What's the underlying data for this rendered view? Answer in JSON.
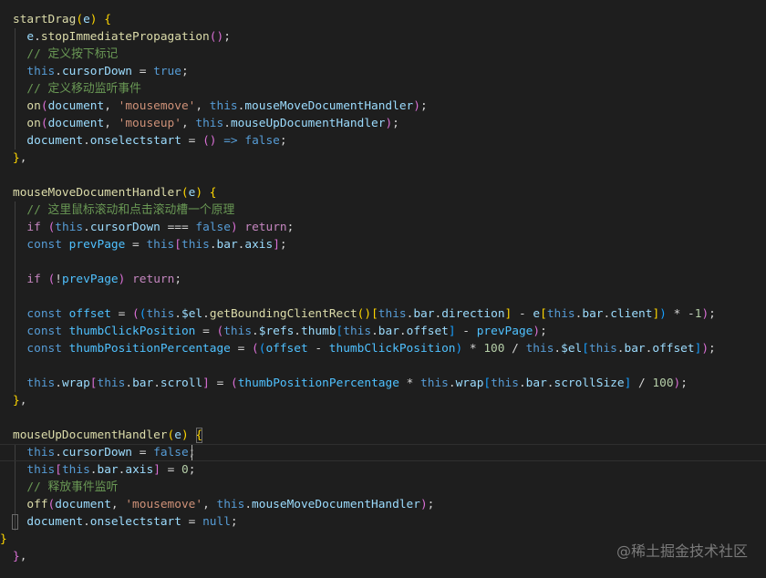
{
  "editor": {
    "lines": [
      [
        [
          "t-fn",
          "startDrag"
        ],
        [
          "t-br1",
          "("
        ],
        [
          "t-var",
          "e"
        ],
        [
          "t-br1",
          ")"
        ],
        [
          "t-pun",
          " "
        ],
        [
          "t-br1",
          "{"
        ]
      ],
      [
        [
          "t-pun",
          "  "
        ],
        [
          "t-var",
          "e"
        ],
        [
          "t-pun",
          "."
        ],
        [
          "t-fn",
          "stopImmediatePropagation"
        ],
        [
          "t-br2",
          "()"
        ],
        [
          "t-pun",
          ";"
        ]
      ],
      [
        [
          "t-pun",
          "  "
        ],
        [
          "t-cmt",
          "// 定义按下标记"
        ]
      ],
      [
        [
          "t-pun",
          "  "
        ],
        [
          "t-kw",
          "this"
        ],
        [
          "t-pun",
          "."
        ],
        [
          "t-var",
          "cursorDown"
        ],
        [
          "t-op",
          " = "
        ],
        [
          "t-kw",
          "true"
        ],
        [
          "t-pun",
          ";"
        ]
      ],
      [
        [
          "t-pun",
          "  "
        ],
        [
          "t-cmt",
          "// 定义移动监听事件"
        ]
      ],
      [
        [
          "t-pun",
          "  "
        ],
        [
          "t-fn",
          "on"
        ],
        [
          "t-br2",
          "("
        ],
        [
          "t-var",
          "document"
        ],
        [
          "t-pun",
          ", "
        ],
        [
          "t-str",
          "'mousemove'"
        ],
        [
          "t-pun",
          ", "
        ],
        [
          "t-kw",
          "this"
        ],
        [
          "t-pun",
          "."
        ],
        [
          "t-var",
          "mouseMoveDocumentHandler"
        ],
        [
          "t-br2",
          ")"
        ],
        [
          "t-pun",
          ";"
        ]
      ],
      [
        [
          "t-pun",
          "  "
        ],
        [
          "t-fn",
          "on"
        ],
        [
          "t-br2",
          "("
        ],
        [
          "t-var",
          "document"
        ],
        [
          "t-pun",
          ", "
        ],
        [
          "t-str",
          "'mouseup'"
        ],
        [
          "t-pun",
          ", "
        ],
        [
          "t-kw",
          "this"
        ],
        [
          "t-pun",
          "."
        ],
        [
          "t-var",
          "mouseUpDocumentHandler"
        ],
        [
          "t-br2",
          ")"
        ],
        [
          "t-pun",
          ";"
        ]
      ],
      [
        [
          "t-pun",
          "  "
        ],
        [
          "t-var",
          "document"
        ],
        [
          "t-pun",
          "."
        ],
        [
          "t-var",
          "onselectstart"
        ],
        [
          "t-op",
          " = "
        ],
        [
          "t-br2",
          "()"
        ],
        [
          "t-op",
          " "
        ],
        [
          "t-kw",
          "=>"
        ],
        [
          "t-pun",
          " "
        ],
        [
          "t-kw",
          "false"
        ],
        [
          "t-pun",
          ";"
        ]
      ],
      [
        [
          "t-br1",
          "}"
        ],
        [
          "t-pun",
          ","
        ]
      ],
      [],
      [
        [
          "t-fn",
          "mouseMoveDocumentHandler"
        ],
        [
          "t-br1",
          "("
        ],
        [
          "t-var",
          "e"
        ],
        [
          "t-br1",
          ")"
        ],
        [
          "t-pun",
          " "
        ],
        [
          "t-br1",
          "{"
        ]
      ],
      [
        [
          "t-pun",
          "  "
        ],
        [
          "t-cmt",
          "// 这里鼠标滚动和点击滚动槽一个原理"
        ]
      ],
      [
        [
          "t-pun",
          "  "
        ],
        [
          "t-ctrl",
          "if"
        ],
        [
          "t-pun",
          " "
        ],
        [
          "t-br2",
          "("
        ],
        [
          "t-kw",
          "this"
        ],
        [
          "t-pun",
          "."
        ],
        [
          "t-var",
          "cursorDown"
        ],
        [
          "t-op",
          " === "
        ],
        [
          "t-kw",
          "false"
        ],
        [
          "t-br2",
          ")"
        ],
        [
          "t-pun",
          " "
        ],
        [
          "t-ctrl",
          "return"
        ],
        [
          "t-pun",
          ";"
        ]
      ],
      [
        [
          "t-pun",
          "  "
        ],
        [
          "t-kw",
          "const"
        ],
        [
          "t-pun",
          " "
        ],
        [
          "t-const",
          "prevPage"
        ],
        [
          "t-op",
          " = "
        ],
        [
          "t-kw",
          "this"
        ],
        [
          "t-br2",
          "["
        ],
        [
          "t-kw",
          "this"
        ],
        [
          "t-pun",
          "."
        ],
        [
          "t-var",
          "bar"
        ],
        [
          "t-pun",
          "."
        ],
        [
          "t-var",
          "axis"
        ],
        [
          "t-br2",
          "]"
        ],
        [
          "t-pun",
          ";"
        ]
      ],
      [],
      [
        [
          "t-pun",
          "  "
        ],
        [
          "t-ctrl",
          "if"
        ],
        [
          "t-pun",
          " "
        ],
        [
          "t-br2",
          "("
        ],
        [
          "t-op",
          "!"
        ],
        [
          "t-const",
          "prevPage"
        ],
        [
          "t-br2",
          ")"
        ],
        [
          "t-pun",
          " "
        ],
        [
          "t-ctrl",
          "return"
        ],
        [
          "t-pun",
          ";"
        ]
      ],
      [],
      [
        [
          "t-pun",
          "  "
        ],
        [
          "t-kw",
          "const"
        ],
        [
          "t-pun",
          " "
        ],
        [
          "t-const",
          "offset"
        ],
        [
          "t-op",
          " = "
        ],
        [
          "t-br2",
          "("
        ],
        [
          "t-br3",
          "("
        ],
        [
          "t-kw",
          "this"
        ],
        [
          "t-pun",
          "."
        ],
        [
          "t-var",
          "$el"
        ],
        [
          "t-pun",
          "."
        ],
        [
          "t-fn",
          "getBoundingClientRect"
        ],
        [
          "t-br1",
          "()"
        ],
        [
          "t-br1",
          "["
        ],
        [
          "t-kw",
          "this"
        ],
        [
          "t-pun",
          "."
        ],
        [
          "t-var",
          "bar"
        ],
        [
          "t-pun",
          "."
        ],
        [
          "t-var",
          "direction"
        ],
        [
          "t-br1",
          "]"
        ],
        [
          "t-op",
          " - "
        ],
        [
          "t-var",
          "e"
        ],
        [
          "t-br1",
          "["
        ],
        [
          "t-kw",
          "this"
        ],
        [
          "t-pun",
          "."
        ],
        [
          "t-var",
          "bar"
        ],
        [
          "t-pun",
          "."
        ],
        [
          "t-var",
          "client"
        ],
        [
          "t-br1",
          "]"
        ],
        [
          "t-br3",
          ")"
        ],
        [
          "t-op",
          " * "
        ],
        [
          "t-op",
          "-"
        ],
        [
          "t-num",
          "1"
        ],
        [
          "t-br2",
          ")"
        ],
        [
          "t-pun",
          ";"
        ]
      ],
      [
        [
          "t-pun",
          "  "
        ],
        [
          "t-kw",
          "const"
        ],
        [
          "t-pun",
          " "
        ],
        [
          "t-const",
          "thumbClickPosition"
        ],
        [
          "t-op",
          " = "
        ],
        [
          "t-br2",
          "("
        ],
        [
          "t-kw",
          "this"
        ],
        [
          "t-pun",
          "."
        ],
        [
          "t-var",
          "$refs"
        ],
        [
          "t-pun",
          "."
        ],
        [
          "t-var",
          "thumb"
        ],
        [
          "t-br3",
          "["
        ],
        [
          "t-kw",
          "this"
        ],
        [
          "t-pun",
          "."
        ],
        [
          "t-var",
          "bar"
        ],
        [
          "t-pun",
          "."
        ],
        [
          "t-var",
          "offset"
        ],
        [
          "t-br3",
          "]"
        ],
        [
          "t-op",
          " - "
        ],
        [
          "t-const",
          "prevPage"
        ],
        [
          "t-br2",
          ")"
        ],
        [
          "t-pun",
          ";"
        ]
      ],
      [
        [
          "t-pun",
          "  "
        ],
        [
          "t-kw",
          "const"
        ],
        [
          "t-pun",
          " "
        ],
        [
          "t-const",
          "thumbPositionPercentage"
        ],
        [
          "t-op",
          " = "
        ],
        [
          "t-br2",
          "("
        ],
        [
          "t-br3",
          "("
        ],
        [
          "t-const",
          "offset"
        ],
        [
          "t-op",
          " - "
        ],
        [
          "t-const",
          "thumbClickPosition"
        ],
        [
          "t-br3",
          ")"
        ],
        [
          "t-op",
          " * "
        ],
        [
          "t-num",
          "100"
        ],
        [
          "t-op",
          " / "
        ],
        [
          "t-kw",
          "this"
        ],
        [
          "t-pun",
          "."
        ],
        [
          "t-var",
          "$el"
        ],
        [
          "t-br3",
          "["
        ],
        [
          "t-kw",
          "this"
        ],
        [
          "t-pun",
          "."
        ],
        [
          "t-var",
          "bar"
        ],
        [
          "t-pun",
          "."
        ],
        [
          "t-var",
          "offset"
        ],
        [
          "t-br3",
          "]"
        ],
        [
          "t-br2",
          ")"
        ],
        [
          "t-pun",
          ";"
        ]
      ],
      [],
      [
        [
          "t-pun",
          "  "
        ],
        [
          "t-kw",
          "this"
        ],
        [
          "t-pun",
          "."
        ],
        [
          "t-var",
          "wrap"
        ],
        [
          "t-br2",
          "["
        ],
        [
          "t-kw",
          "this"
        ],
        [
          "t-pun",
          "."
        ],
        [
          "t-var",
          "bar"
        ],
        [
          "t-pun",
          "."
        ],
        [
          "t-var",
          "scroll"
        ],
        [
          "t-br2",
          "]"
        ],
        [
          "t-op",
          " = "
        ],
        [
          "t-br2",
          "("
        ],
        [
          "t-const",
          "thumbPositionPercentage"
        ],
        [
          "t-op",
          " * "
        ],
        [
          "t-kw",
          "this"
        ],
        [
          "t-pun",
          "."
        ],
        [
          "t-var",
          "wrap"
        ],
        [
          "t-br3",
          "["
        ],
        [
          "t-kw",
          "this"
        ],
        [
          "t-pun",
          "."
        ],
        [
          "t-var",
          "bar"
        ],
        [
          "t-pun",
          "."
        ],
        [
          "t-var",
          "scrollSize"
        ],
        [
          "t-br3",
          "]"
        ],
        [
          "t-op",
          " / "
        ],
        [
          "t-num",
          "100"
        ],
        [
          "t-br2",
          ")"
        ],
        [
          "t-pun",
          ";"
        ]
      ],
      [
        [
          "t-br1",
          "}"
        ],
        [
          "t-pun",
          ","
        ]
      ],
      [],
      [
        [
          "t-fn",
          "mouseUpDocumentHandler"
        ],
        [
          "t-br1",
          "("
        ],
        [
          "t-var",
          "e"
        ],
        [
          "t-br1",
          ")"
        ],
        [
          "t-pun",
          " "
        ],
        [
          "t-br1",
          "{"
        ]
      ],
      [
        [
          "t-pun",
          "  "
        ],
        [
          "t-kw",
          "this"
        ],
        [
          "t-pun",
          "."
        ],
        [
          "t-var",
          "cursorDown"
        ],
        [
          "t-op",
          " = "
        ],
        [
          "t-kw",
          "false"
        ],
        [
          "t-pun",
          ";"
        ]
      ],
      [
        [
          "t-pun",
          "  "
        ],
        [
          "t-kw",
          "this"
        ],
        [
          "t-br2",
          "["
        ],
        [
          "t-kw",
          "this"
        ],
        [
          "t-pun",
          "."
        ],
        [
          "t-var",
          "bar"
        ],
        [
          "t-pun",
          "."
        ],
        [
          "t-var",
          "axis"
        ],
        [
          "t-br2",
          "]"
        ],
        [
          "t-op",
          " = "
        ],
        [
          "t-num",
          "0"
        ],
        [
          "t-pun",
          ";"
        ]
      ],
      [
        [
          "t-pun",
          "  "
        ],
        [
          "t-cmt",
          "// 释放事件监听"
        ]
      ],
      [
        [
          "t-pun",
          "  "
        ],
        [
          "t-fn",
          "off"
        ],
        [
          "t-br2",
          "("
        ],
        [
          "t-var",
          "document"
        ],
        [
          "t-pun",
          ", "
        ],
        [
          "t-str",
          "'mousemove'"
        ],
        [
          "t-pun",
          ", "
        ],
        [
          "t-kw",
          "this"
        ],
        [
          "t-pun",
          "."
        ],
        [
          "t-var",
          "mouseMoveDocumentHandler"
        ],
        [
          "t-br2",
          ")"
        ],
        [
          "t-pun",
          ";"
        ]
      ],
      [
        [
          "t-pun",
          "  "
        ],
        [
          "t-var",
          "document"
        ],
        [
          "t-pun",
          "."
        ],
        [
          "t-var",
          "onselectstart"
        ],
        [
          "t-op",
          " = "
        ],
        [
          "t-kw",
          "null"
        ],
        [
          "t-pun",
          ";"
        ]
      ],
      [
        [
          "t-br1",
          "}"
        ]
      ],
      [
        [
          "t-br2",
          "}"
        ],
        [
          "t-pun",
          ","
        ]
      ]
    ]
  },
  "watermark": "@稀土掘金技术社区"
}
